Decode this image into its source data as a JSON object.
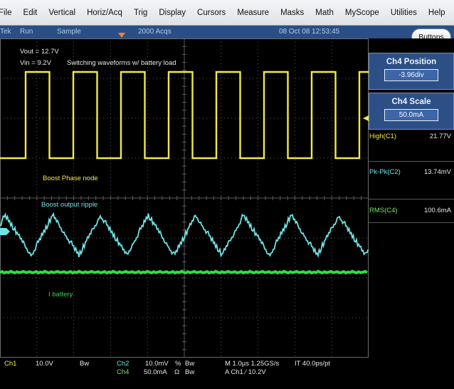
{
  "menu": [
    "File",
    "Edit",
    "Vertical",
    "Horiz/Acq",
    "Trig",
    "Display",
    "Cursors",
    "Measure",
    "Masks",
    "Math",
    "MyScope",
    "Utilities",
    "Help"
  ],
  "status": {
    "state": "Run",
    "mode": "Sample",
    "acqs": "2000 Acqs",
    "datetime": "08 Oct 08 12:53:45"
  },
  "buttons_label": "Buttons",
  "annotations": {
    "vout": "Vout = 12.7V",
    "vin": "Vin = 9.2V",
    "title": "Switching waveforms w/ battery load",
    "boost_phase": "Boost Phase node",
    "boost_ripple": "Boost output ripple",
    "ibattery": "I battery"
  },
  "controls": {
    "position": {
      "title": "Ch4 Position",
      "value": "-3.96div"
    },
    "scale": {
      "title": "Ch4 Scale",
      "value": "50.0mA"
    }
  },
  "measurements": [
    {
      "label": "High(C1)",
      "value": "21.77V"
    },
    {
      "label": "Pk-Pk(C2)",
      "value": "13.74mV"
    },
    {
      "label": "RMS(C4)",
      "value": "100.6mA"
    }
  ],
  "readout": {
    "ch1_label": "Ch1",
    "ch1_scale": "10.0V",
    "ch1_bw": "Bw",
    "ch2_label": "Ch2",
    "ch2_scale": "10.0mV",
    "ch2_sym": "%",
    "ch2_bw": "Bw",
    "ch4_label": "Ch4",
    "ch4_scale": "50.0mA",
    "ch4_sym": "Ω",
    "ch4_bw": "Bw",
    "timebase": "M 1.0µs 1.25GS/s",
    "trig": "A Ch1  ⁄  10.2V",
    "record": "IT 40.0ps/pt"
  },
  "colors": {
    "ch1": "#f1ea48",
    "ch2": "#6fe3e6",
    "ch4": "#38d948",
    "grid": "#5a5a5a",
    "panel": "#2c4f86"
  }
}
